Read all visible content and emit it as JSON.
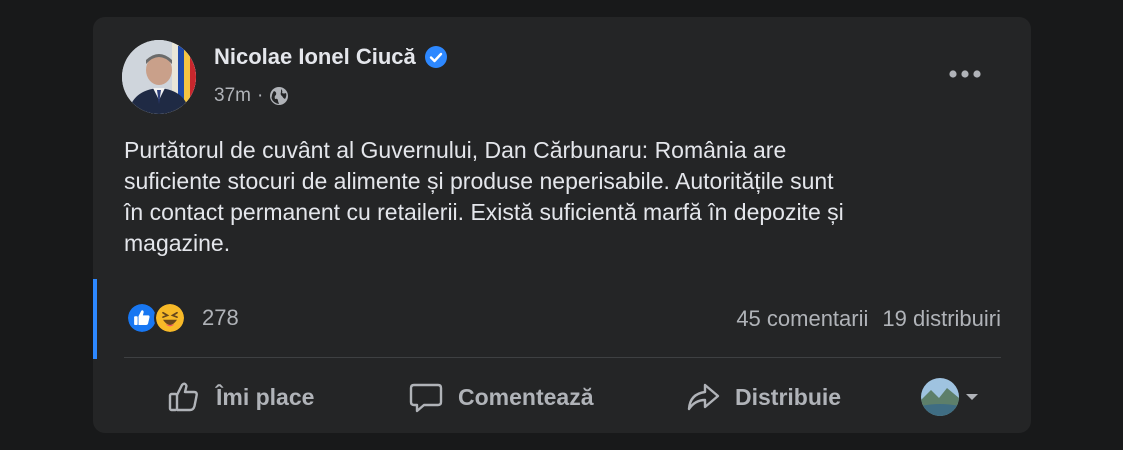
{
  "post": {
    "author": "Nicolae Ionel Ciucă",
    "timestamp": "37m",
    "separator": "·",
    "privacy_icon": "globe-icon",
    "verified_icon": "verified-badge-icon",
    "text_lines": [
      "Purtătorul de cuvânt al Guvernului, Dan Cărbunaru: România are",
      "suficiente stocuri de alimente și produse neperisabile. Autoritățile sunt",
      "în contact permanent cu retailerii. Există suficientă marfă în depozite și",
      "magazine."
    ]
  },
  "engagement": {
    "reaction_icons": [
      "like-reaction-icon",
      "haha-reaction-icon"
    ],
    "reactions_count": "278",
    "comments": "45 comentarii",
    "shares": "19 distribuiri"
  },
  "actions": {
    "like": "Îmi place",
    "comment": "Comentează",
    "share": "Distribuie"
  },
  "colors": {
    "background": "#18191a",
    "card": "#242526",
    "primary_text": "#e4e6eb",
    "secondary_text": "#b0b3b8",
    "accent": "#2d88ff",
    "verified": "#2d88ff",
    "haha": "#f7b928"
  }
}
